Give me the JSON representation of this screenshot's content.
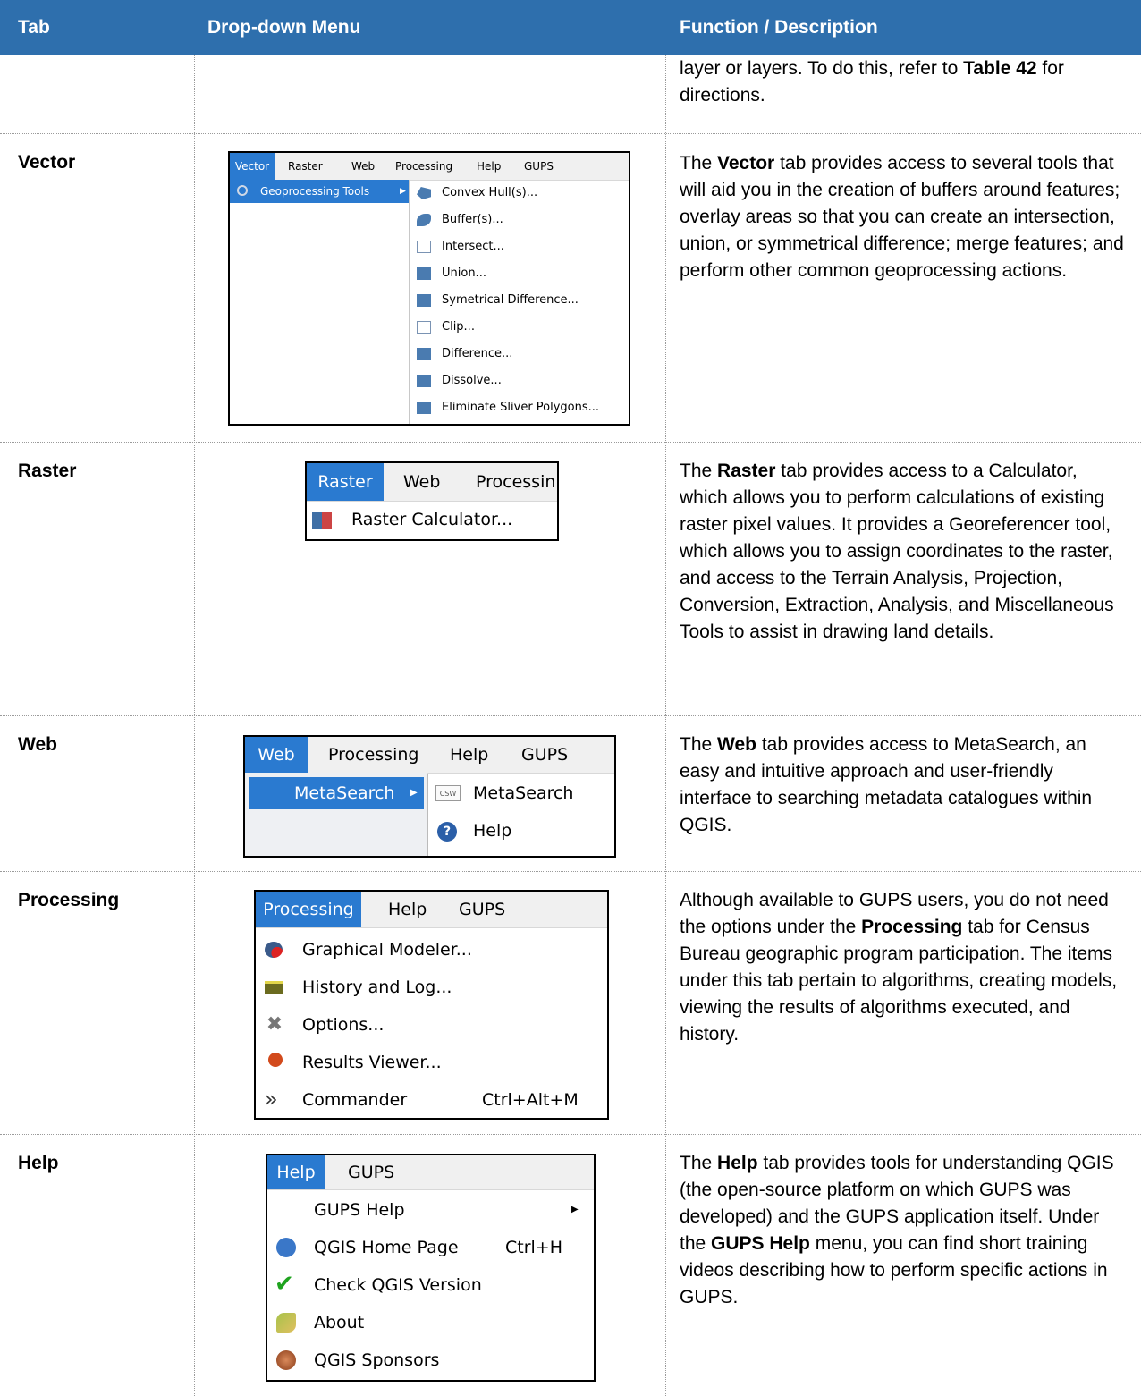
{
  "headers": {
    "tab": "Tab",
    "dropdown": "Drop-down Menu",
    "function": "Function / Description"
  },
  "continued_row": {
    "desc_a": "layer or layers. To do this, refer to ",
    "desc_b": "Table 42",
    "desc_c": " for directions."
  },
  "rows": {
    "vector": {
      "tab": "Vector",
      "desc_pre": "The ",
      "desc_bold": "Vector",
      "desc_post": " tab provides access to several tools that will aid you in the creation of buffers around features; overlay areas so that you can create an intersection, union, or symmetrical difference; merge features; and perform other common geoprocessing actions.",
      "menubar": [
        "Vector",
        "Raster",
        "Web",
        "Processing",
        "Help",
        "GUPS"
      ],
      "submenu": "Geoprocessing Tools",
      "items": [
        "Convex Hull(s)...",
        "Buffer(s)...",
        "Intersect...",
        "Union...",
        "Symetrical Difference...",
        "Clip...",
        "Difference...",
        "Dissolve...",
        "Eliminate Sliver Polygons..."
      ]
    },
    "raster": {
      "tab": "Raster",
      "desc_pre": "The ",
      "desc_bold": "Raster",
      "desc_post": " tab provides access to a Calculator, which allows you to perform calculations of existing raster pixel values. It provides a Georeferencer tool, which allows you to assign coordinates to the raster, and access to the Terrain Analysis, Projection, Conversion, Extraction, Analysis, and Miscellaneous Tools to assist in drawing land details.",
      "menubar": [
        "Raster",
        "Web",
        "Processin"
      ],
      "items": [
        "Raster Calculator..."
      ]
    },
    "web": {
      "tab": "Web",
      "desc_pre": "The ",
      "desc_bold": "Web",
      "desc_post": " tab provides access to MetaSearch, an easy and intuitive approach and user-friendly interface to searching metadata catalogues within QGIS.",
      "menubar": [
        "Web",
        "Processing",
        "Help",
        "GUPS"
      ],
      "submenu": "MetaSearch",
      "items": [
        "MetaSearch",
        "Help"
      ],
      "csw": "CSW"
    },
    "processing": {
      "tab": "Processing",
      "desc_pre": "Although available to GUPS users, you do not need the options under the ",
      "desc_bold": "Processing",
      "desc_post": " tab for Census Bureau geographic program participation. The items under this tab pertain to algorithms, creating models, viewing the results of algorithms executed, and history.",
      "menubar": [
        "Processing",
        "Help",
        "GUPS"
      ],
      "items": [
        "Graphical Modeler...",
        "History and Log...",
        "Options...",
        "Results Viewer...",
        "Commander"
      ],
      "shortcut": "Ctrl+Alt+M"
    },
    "help": {
      "tab": "Help",
      "desc_pre": "The ",
      "desc_bold": "Help",
      "desc_mid": " tab provides tools for understanding QGIS (the open-source platform on which GUPS was developed) and the GUPS application itself. Under the ",
      "desc_bold2": "GUPS Help",
      "desc_post": " menu, you can find short training videos describing how to perform specific actions in GUPS.",
      "menubar": [
        "Help",
        "GUPS"
      ],
      "items": [
        "GUPS Help",
        "QGIS Home Page",
        "Check QGIS Version",
        "About",
        "QGIS Sponsors"
      ],
      "shortcut": "Ctrl+H"
    }
  },
  "colors": {
    "header_bg": "#2e6fad",
    "menu_highlight": "#2a7ad0"
  }
}
